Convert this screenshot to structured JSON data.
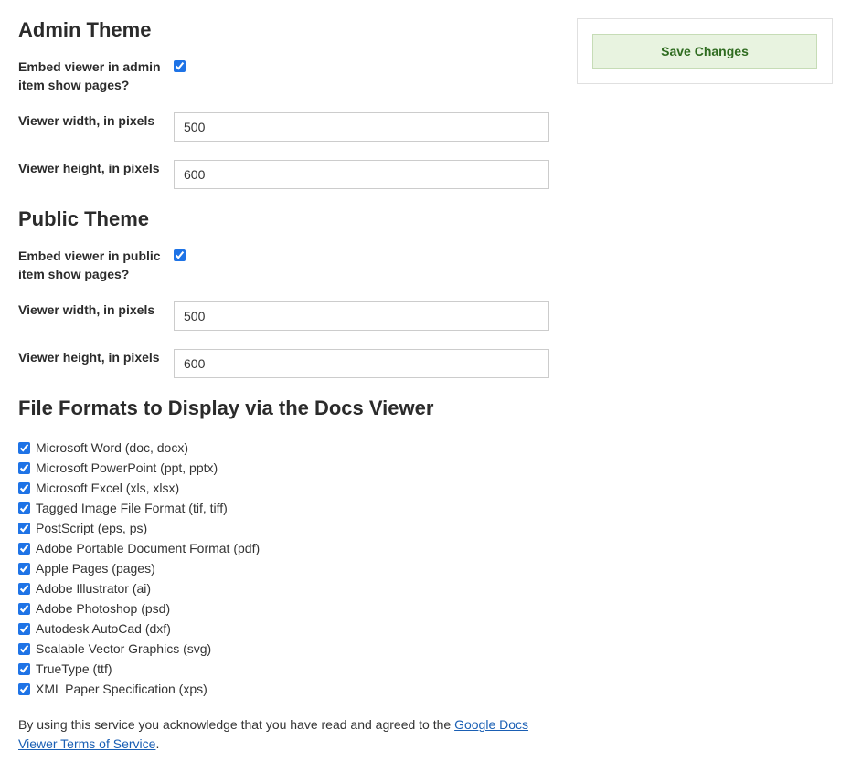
{
  "sidebar": {
    "save_label": "Save Changes"
  },
  "admin_theme": {
    "heading": "Admin Theme",
    "embed_label": "Embed viewer in admin item show pages?",
    "embed_checked": true,
    "width_label": "Viewer width, in pixels",
    "width_value": "500",
    "height_label": "Viewer height, in pixels",
    "height_value": "600"
  },
  "public_theme": {
    "heading": "Public Theme",
    "embed_label": "Embed viewer in public item show pages?",
    "embed_checked": true,
    "width_label": "Viewer width, in pixels",
    "width_value": "500",
    "height_label": "Viewer height, in pixels",
    "height_value": "600"
  },
  "file_formats": {
    "heading": "File Formats to Display via the Docs Viewer",
    "items": [
      {
        "label": "Microsoft Word (doc, docx)",
        "checked": true
      },
      {
        "label": "Microsoft PowerPoint (ppt, pptx)",
        "checked": true
      },
      {
        "label": "Microsoft Excel (xls, xlsx)",
        "checked": true
      },
      {
        "label": "Tagged Image File Format (tif, tiff)",
        "checked": true
      },
      {
        "label": "PostScript (eps, ps)",
        "checked": true
      },
      {
        "label": "Adobe Portable Document Format (pdf)",
        "checked": true
      },
      {
        "label": "Apple Pages (pages)",
        "checked": true
      },
      {
        "label": "Adobe Illustrator (ai)",
        "checked": true
      },
      {
        "label": "Adobe Photoshop (psd)",
        "checked": true
      },
      {
        "label": "Autodesk AutoCad (dxf)",
        "checked": true
      },
      {
        "label": "Scalable Vector Graphics (svg)",
        "checked": true
      },
      {
        "label": "TrueType (ttf)",
        "checked": true
      },
      {
        "label": "XML Paper Specification (xps)",
        "checked": true
      }
    ]
  },
  "disclaimer": {
    "prefix": "By using this service you acknowledge that you have read and agreed to the ",
    "link_text": "Google Docs Viewer Terms of Service",
    "suffix": "."
  }
}
